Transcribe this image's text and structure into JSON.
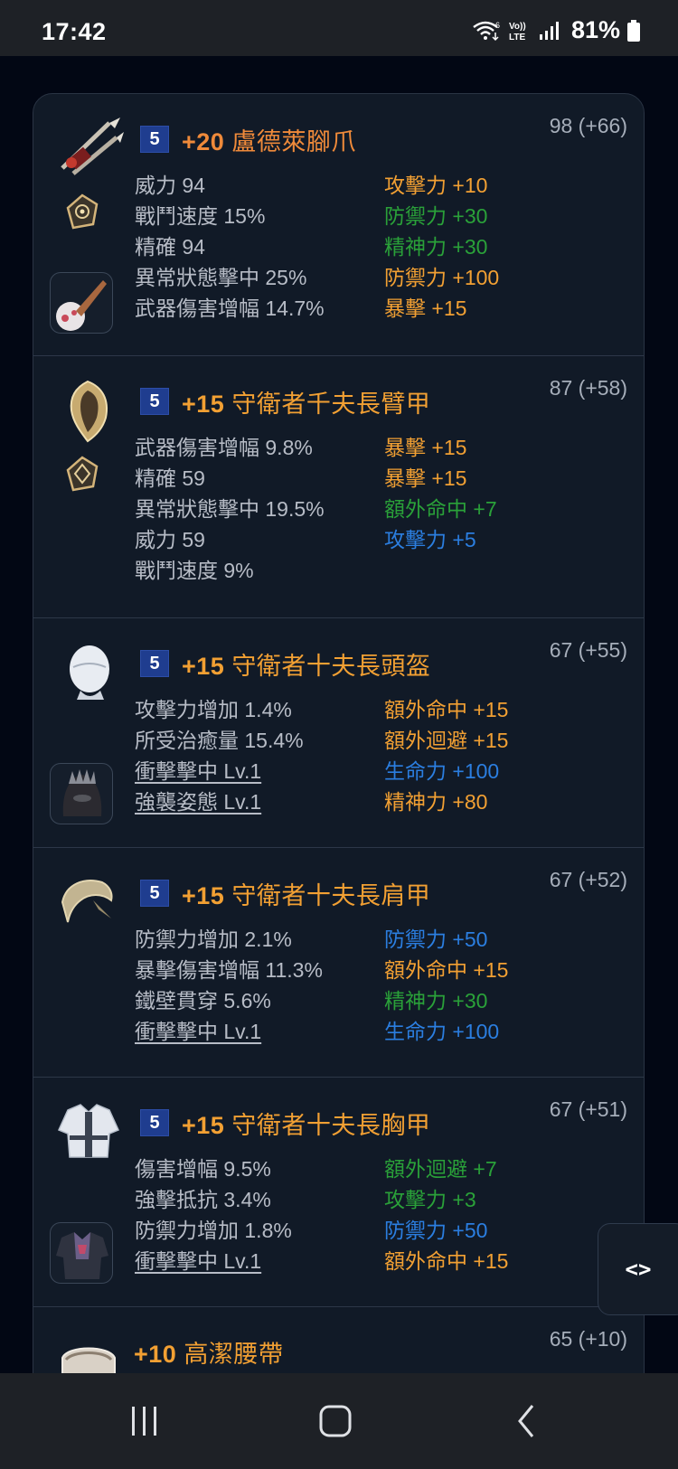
{
  "status_bar": {
    "time": "17:42",
    "battery": "81%"
  },
  "items": [
    {
      "score": "98 (+66)",
      "tier": "5",
      "enhance": "+20",
      "name": "盧德萊腳爪",
      "title_color": "#ef8a3a",
      "left_stats": [
        {
          "text": "威力 94",
          "link": false
        },
        {
          "text": "戰鬥速度 15%",
          "link": false
        },
        {
          "text": "精確 94",
          "link": false
        },
        {
          "text": "異常狀態擊中 25%",
          "link": false
        },
        {
          "text": "武器傷害增幅 14.7%",
          "link": false
        }
      ],
      "right_stats": [
        {
          "text": "攻擊力 +10",
          "color": "orange"
        },
        {
          "text": "防禦力 +30",
          "color": "green"
        },
        {
          "text": "精神力 +30",
          "color": "green"
        },
        {
          "text": "防禦力 +100",
          "color": "orange"
        },
        {
          "text": "暴擊 +15",
          "color": "orange"
        }
      ],
      "icons": [
        "twin-claw-weapon-icon",
        "manastone-icon",
        "skill-gem-icon"
      ]
    },
    {
      "score": "87 (+58)",
      "tier": "5",
      "enhance": "+15",
      "name": "守衛者千夫長臂甲",
      "title_color": "#f2a033",
      "left_stats": [
        {
          "text": "武器傷害增幅 9.8%",
          "link": false
        },
        {
          "text": "精確 59",
          "link": false
        },
        {
          "text": "異常狀態擊中 19.5%",
          "link": false
        },
        {
          "text": "威力 59",
          "link": false
        },
        {
          "text": "戰鬥速度 9%",
          "link": false
        }
      ],
      "right_stats": [
        {
          "text": "暴擊 +15",
          "color": "orange"
        },
        {
          "text": "暴擊 +15",
          "color": "orange"
        },
        {
          "text": "額外命中 +7",
          "color": "green"
        },
        {
          "text": "攻擊力 +5",
          "color": "blue"
        }
      ],
      "icons": [
        "shield-armguard-icon",
        "manastone-icon"
      ]
    },
    {
      "score": "67 (+55)",
      "tier": "5",
      "enhance": "+15",
      "name": "守衛者十夫長頭盔",
      "title_color": "#f2a033",
      "left_stats": [
        {
          "text": "攻擊力增加 1.4%",
          "link": false
        },
        {
          "text": "所受治癒量 15.4%",
          "link": false
        },
        {
          "text": "衝擊擊中 Lv.1",
          "link": true
        },
        {
          "text": "強襲姿態 Lv.1",
          "link": true
        }
      ],
      "right_stats": [
        {
          "text": "額外命中 +15",
          "color": "orange"
        },
        {
          "text": "額外迴避 +15",
          "color": "orange"
        },
        {
          "text": "生命力 +100",
          "color": "blue"
        },
        {
          "text": "精神力 +80",
          "color": "orange"
        }
      ],
      "icons": [
        "helmet-icon",
        "skin-helmet-icon"
      ]
    },
    {
      "score": "67 (+52)",
      "tier": "5",
      "enhance": "+15",
      "name": "守衛者十夫長肩甲",
      "title_color": "#f2a033",
      "left_stats": [
        {
          "text": "防禦力增加 2.1%",
          "link": false
        },
        {
          "text": "暴擊傷害增幅 11.3%",
          "link": false
        },
        {
          "text": "鐵壁貫穿 5.6%",
          "link": false
        },
        {
          "text": "衝擊擊中 Lv.1",
          "link": true
        }
      ],
      "right_stats": [
        {
          "text": "防禦力 +50",
          "color": "blue"
        },
        {
          "text": "額外命中 +15",
          "color": "orange"
        },
        {
          "text": "精神力 +30",
          "color": "green"
        },
        {
          "text": "生命力 +100",
          "color": "blue"
        }
      ],
      "icons": [
        "pauldron-icon"
      ]
    },
    {
      "score": "67 (+51)",
      "tier": "5",
      "enhance": "+15",
      "name": "守衛者十夫長胸甲",
      "title_color": "#f2a033",
      "left_stats": [
        {
          "text": "傷害增幅 9.5%",
          "link": false
        },
        {
          "text": "強擊抵抗 3.4%",
          "link": false
        },
        {
          "text": "防禦力增加 1.8%",
          "link": false
        },
        {
          "text": "衝擊擊中 Lv.1",
          "link": true
        }
      ],
      "right_stats": [
        {
          "text": "額外迴避 +7",
          "color": "green"
        },
        {
          "text": "攻擊力 +3",
          "color": "green"
        },
        {
          "text": "防禦力 +50",
          "color": "blue"
        },
        {
          "text": "額外命中 +15",
          "color": "orange"
        }
      ],
      "icons": [
        "chest-armor-icon",
        "skin-armor-icon"
      ]
    },
    {
      "score": "65 (+10)",
      "enhance": "+10",
      "name": "高潔腰帶",
      "title_color": "#f2a033",
      "icons": [
        "belt-icon"
      ]
    }
  ],
  "side_button": {
    "label": "<>"
  },
  "colors": {
    "orange": "#f2a033",
    "green": "#2aa139",
    "blue": "#2b7ee0",
    "badge": "#1f3d8f",
    "panel": "#111a27"
  }
}
